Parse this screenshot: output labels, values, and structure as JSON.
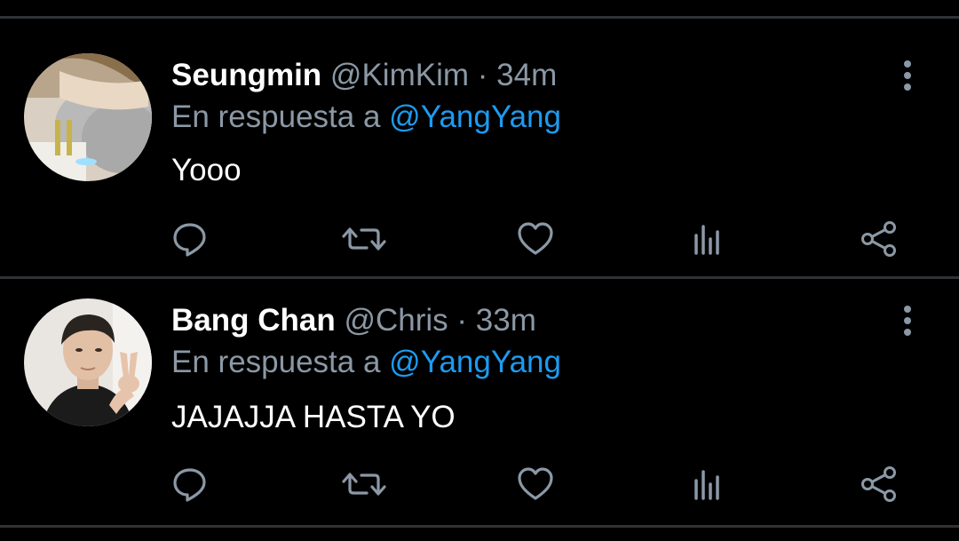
{
  "colors": {
    "background": "#000000",
    "divider": "#2f3336",
    "name": "#ffffff",
    "secondary": "#8b98a5",
    "mention": "#1d9bf0",
    "icon": "#8b98a5"
  },
  "tweets": [
    {
      "display_name": "Seungmin",
      "handle": "@KimKim",
      "separator": "·",
      "time": "34m",
      "reply_prefix": "En respuesta a",
      "reply_to": "@YangYang",
      "text": "Yooo",
      "avatar": "profile-photo",
      "actions": [
        "reply-icon",
        "retweet-icon",
        "like-icon",
        "analytics-icon",
        "share-icon"
      ]
    },
    {
      "display_name": "Bang Chan",
      "handle": "@Chris",
      "separator": "·",
      "time": "33m",
      "reply_prefix": "En respuesta a",
      "reply_to": "@YangYang",
      "text": "JAJAJJA HASTA YO",
      "avatar": "profile-photo",
      "actions": [
        "reply-icon",
        "retweet-icon",
        "like-icon",
        "analytics-icon",
        "share-icon"
      ]
    }
  ]
}
